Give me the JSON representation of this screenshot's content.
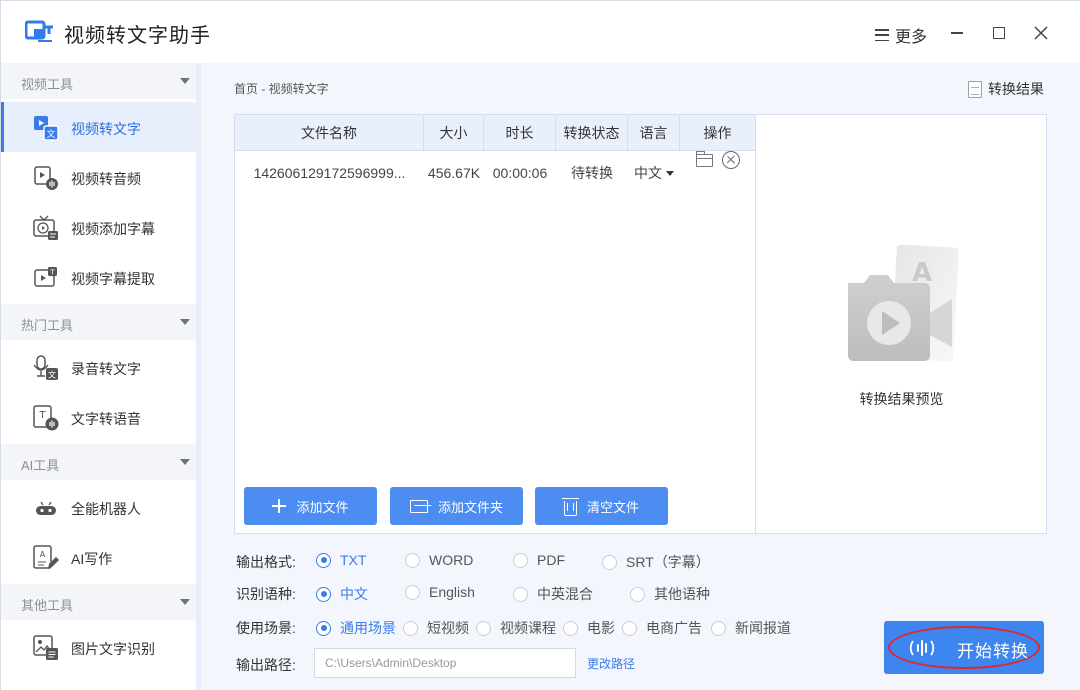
{
  "app": {
    "title": "视频转文字助手",
    "more_label": "更多"
  },
  "sidebar": {
    "sections": [
      {
        "title": "视频工具",
        "items": [
          {
            "label": "视频转文字",
            "icon": "video-to-text-icon"
          },
          {
            "label": "视频转音频",
            "icon": "video-to-audio-icon"
          },
          {
            "label": "视频添加字幕",
            "icon": "video-subtitle-icon"
          },
          {
            "label": "视频字幕提取",
            "icon": "subtitle-extract-icon"
          }
        ]
      },
      {
        "title": "热门工具",
        "items": [
          {
            "label": "录音转文字",
            "icon": "audio-to-text-icon"
          },
          {
            "label": "文字转语音",
            "icon": "text-to-speech-icon"
          }
        ]
      },
      {
        "title": "AI工具",
        "items": [
          {
            "label": "全能机器人",
            "icon": "robot-icon"
          },
          {
            "label": "AI写作",
            "icon": "ai-writing-icon"
          }
        ]
      },
      {
        "title": "其他工具",
        "items": [
          {
            "label": "图片文字识别",
            "icon": "image-ocr-icon"
          }
        ]
      }
    ]
  },
  "main": {
    "breadcrumb": "首页 - 视频转文字",
    "result_link": "转换结果",
    "table": {
      "headers": [
        "文件名称",
        "大小",
        "时长",
        "转换状态",
        "语言",
        "操作"
      ],
      "rows": [
        {
          "name": "142606129172596999...",
          "size": "456.67K",
          "duration": "00:00:06",
          "status": "待转换",
          "language": "中文"
        }
      ]
    },
    "buttons": {
      "add_file": "添加文件",
      "add_folder": "添加文件夹",
      "clear_files": "清空文件"
    },
    "preview_label": "转换结果预览",
    "options": {
      "format": {
        "label": "输出格式:",
        "choices": [
          "TXT",
          "WORD",
          "PDF",
          "SRT（字幕）"
        ],
        "selected": "TXT"
      },
      "language": {
        "label": "识别语种:",
        "choices": [
          "中文",
          "English",
          "中英混合",
          "其他语种"
        ],
        "selected": "中文"
      },
      "scene": {
        "label": "使用场景:",
        "choices": [
          "通用场景",
          "短视频",
          "视频课程",
          "电影",
          "电商广告",
          "新闻报道"
        ],
        "selected": "通用场景"
      }
    },
    "output_path": {
      "label": "输出路径:",
      "value": "C:\\Users\\Admin\\Desktop",
      "change_label": "更改路径"
    },
    "start_button": "开始转换"
  },
  "colors": {
    "accent": "#3a7bea",
    "button": "#4d8cf0",
    "highlight_ring": "#e2262c"
  }
}
